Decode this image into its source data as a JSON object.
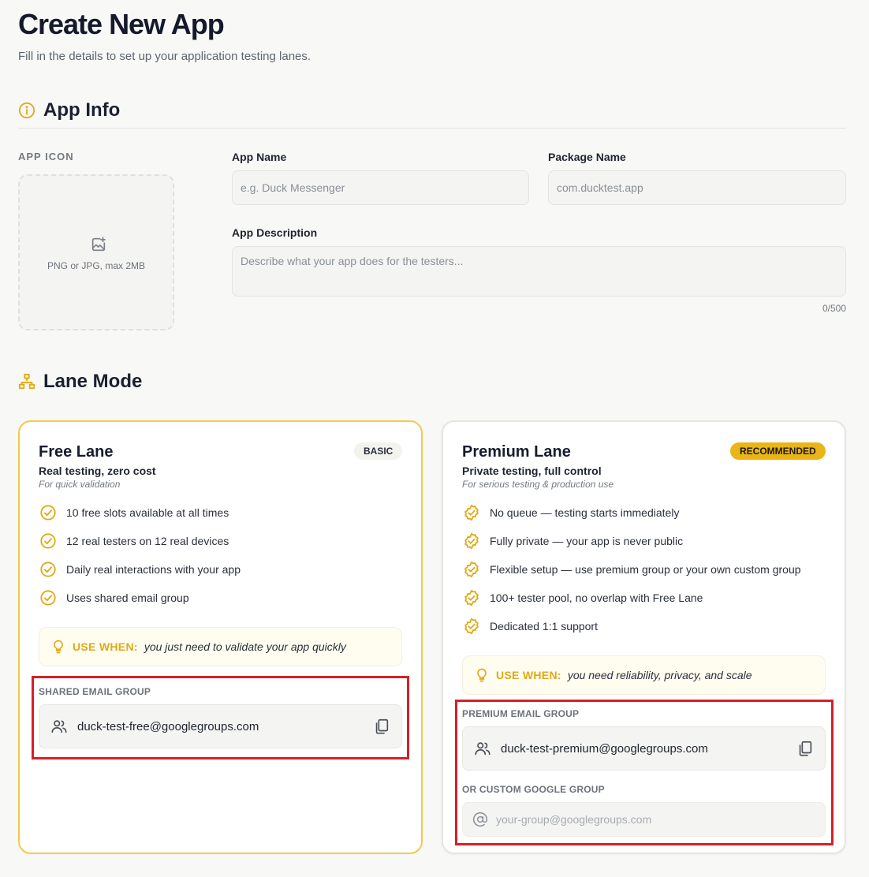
{
  "header": {
    "title": "Create New App",
    "subtitle": "Fill in the details to set up your application testing lanes."
  },
  "app_info": {
    "title": "App Info",
    "icon_label": "APP ICON",
    "icon_hint": "PNG or JPG, max 2MB",
    "app_name_label": "App Name",
    "app_name_placeholder": "e.g. Duck Messenger",
    "package_name_label": "Package Name",
    "package_name_placeholder": "com.ducktest.app",
    "description_label": "App Description",
    "description_placeholder": "Describe what your app does for the testers...",
    "description_counter": "0/500"
  },
  "lane_mode": {
    "title": "Lane Mode",
    "free": {
      "title": "Free Lane",
      "badge": "BASIC",
      "tagline": "Real testing, zero cost",
      "note": "For quick validation",
      "features": [
        "10 free slots available at all times",
        "12 real testers on 12 real devices",
        "Daily real interactions with your app",
        "Uses shared email group"
      ],
      "use_when_label": "USE WHEN:",
      "use_when_text": "you just need to validate your app quickly",
      "group_label": "SHARED EMAIL GROUP",
      "group_email": "duck-test-free@googlegroups.com"
    },
    "premium": {
      "title": "Premium Lane",
      "badge": "RECOMMENDED",
      "tagline": "Private testing, full control",
      "note": "For serious testing & production use",
      "features": [
        "No queue — testing starts immediately",
        "Fully private — your app is never public",
        "Flexible setup — use premium group or your own custom group",
        "100+ tester pool, no overlap with Free Lane",
        "Dedicated 1:1 support"
      ],
      "use_when_label": "USE WHEN:",
      "use_when_text": "you need reliability, privacy, and scale",
      "group_label": "PREMIUM EMAIL GROUP",
      "group_email": "duck-test-premium@googlegroups.com",
      "custom_group_label": "OR CUSTOM GOOGLE GROUP",
      "custom_group_placeholder": "your-group@googlegroups.com"
    }
  },
  "colors": {
    "accent": "#e9b517",
    "highlight": "#d81f26",
    "free_border": "#f2c94c"
  }
}
